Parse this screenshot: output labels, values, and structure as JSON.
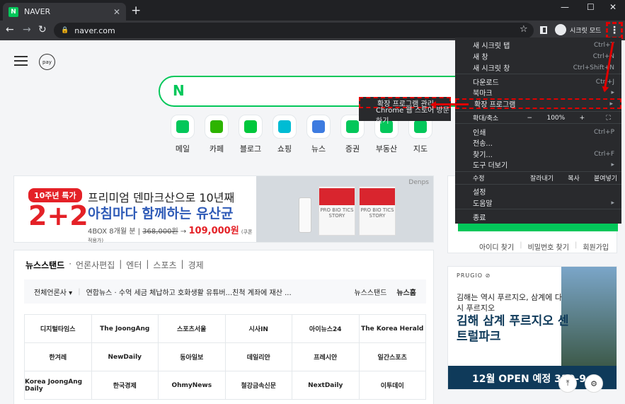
{
  "browser": {
    "tab_favicon": "N",
    "tab_title": "NAVER",
    "tab_close": "✕",
    "new_tab": "+",
    "win_min": "—",
    "win_max": "☐",
    "win_close": "✕",
    "back": "←",
    "forward": "→",
    "reload": "↻",
    "lock": "🔒",
    "url": "naver.com",
    "star": "☆",
    "incognito_label": "시크릿 모드",
    "kebab": "⋮"
  },
  "naver": {
    "pay": "pay",
    "search_logo": "N",
    "quick": [
      {
        "label": "메일",
        "color": "#03c75a"
      },
      {
        "label": "카페",
        "color": "#2db400"
      },
      {
        "label": "블로그",
        "color": "#00c73c"
      },
      {
        "label": "쇼핑",
        "color": "#00bcd4"
      },
      {
        "label": "뉴스",
        "color": "#3d7be0"
      },
      {
        "label": "증권",
        "color": "#03c75a"
      },
      {
        "label": "부동산",
        "color": "#03c75a"
      },
      {
        "label": "지도",
        "color": "#03c75a"
      }
    ]
  },
  "banner": {
    "badge": "10주년 특가",
    "big": "2+2",
    "line1": "프리미엄 덴마크산으로 10년째",
    "line2": "아침마다 함께하는 유산균",
    "detail_prefix": "4BOX 8개월 분 |",
    "price_old": "368,000원",
    "price_new": "109,000원",
    "price_note": "(쿠폰 적용가)",
    "brand": "Denps",
    "box_text": "PRO BIO TICS STORY"
  },
  "news": {
    "tabs": [
      {
        "label": "뉴스스탠드",
        "active": true
      },
      {
        "label": "·"
      },
      {
        "label": "언론사편집"
      },
      {
        "label": "|"
      },
      {
        "label": "엔터"
      },
      {
        "label": "|"
      },
      {
        "label": "스포츠"
      },
      {
        "label": "|"
      },
      {
        "label": "경제"
      }
    ],
    "ticker_source": "전체언론사 ▾",
    "ticker_sep": "|",
    "ticker_headline": "연합뉴스 · 수억 세금 체납하고 호화생활 유튜버...친척 계좌에 재산 ...",
    "ticker_right1": "뉴스스탠드",
    "ticker_right2": "뉴스홈",
    "outlets": [
      "디지털타임스",
      "The JoongAng",
      "스포츠서울",
      "시사IN",
      "아이뉴스24",
      "The Korea Herald",
      "한겨레",
      "NewDaily",
      "동아일보",
      "데일리안",
      "프레시안",
      "일간스포츠",
      "Korea JoongAng Daily",
      "한국경제",
      "OhmyNews",
      "철강금속신문",
      "NextDaily",
      "이투데이"
    ]
  },
  "login": {
    "links": [
      "아이디 찾기",
      "|",
      "비밀번호 찾기",
      "|",
      "회원가입"
    ]
  },
  "ad": {
    "brand": "PRUGIO ⊘",
    "line1": "김해는 역시 푸르지오, 삼계에 다시 푸르지오",
    "line2": "김해 삼계 푸르지오 센트럴파크",
    "bar": "12월 OPEN 예정  330-9"
  },
  "fab": {
    "top": "⤒",
    "settings": "⚙"
  },
  "menu": {
    "items": [
      {
        "label": "새 시크릿 탭",
        "shortcut": "Ctrl+T"
      },
      {
        "label": "새 창",
        "shortcut": "Ctrl+N"
      },
      {
        "label": "새 시크릿 창",
        "shortcut": "Ctrl+Shift+N"
      },
      {
        "label": "다운로드",
        "shortcut": "Ctrl+J"
      },
      {
        "label": "북마크",
        "shortcut": "▸"
      },
      {
        "label": "확장 프로그램",
        "shortcut": "▸"
      },
      {
        "label": "인쇄",
        "shortcut": "Ctrl+P"
      },
      {
        "label": "전송...",
        "shortcut": ""
      },
      {
        "label": "찾기...",
        "shortcut": "Ctrl+F"
      },
      {
        "label": "도구 더보기",
        "shortcut": "▸"
      },
      {
        "label": "설정",
        "shortcut": ""
      },
      {
        "label": "도움말",
        "shortcut": "▸"
      },
      {
        "label": "종료",
        "shortcut": ""
      }
    ],
    "zoom_label": "확대/축소",
    "zoom_minus": "−",
    "zoom_value": "100%",
    "zoom_plus": "+",
    "fullscreen": "⛶",
    "edit_label": "수정",
    "cut": "잘라내기",
    "copy": "복사",
    "paste": "붙여넣기"
  },
  "submenu": {
    "items": [
      "확장 프로그램 관리",
      "Chrome 웹 스토어 방문하기"
    ]
  },
  "colors": {
    "highlight": "#e00000",
    "naver_green": "#03c75a"
  }
}
